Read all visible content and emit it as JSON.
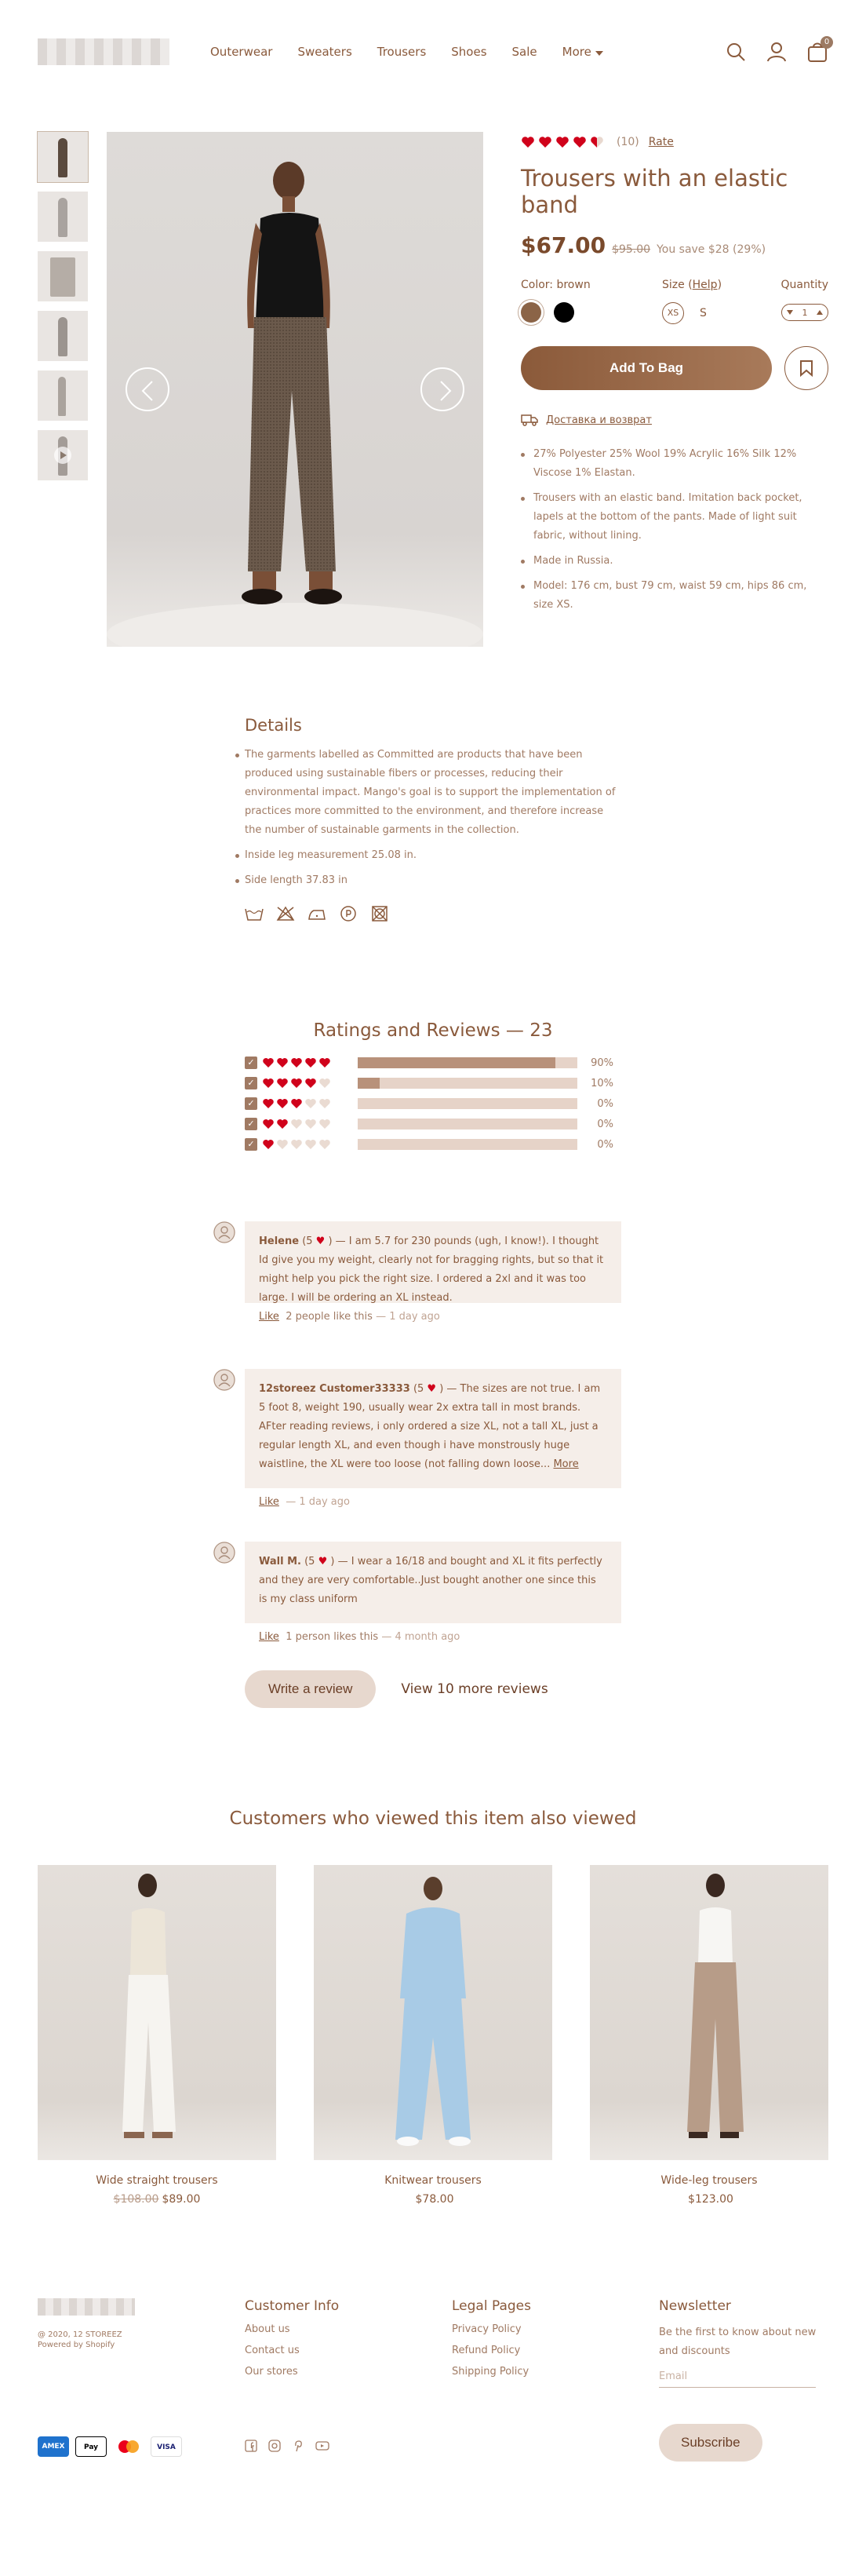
{
  "header": {
    "nav": [
      "Outerwear",
      "Sweaters",
      "Trousers",
      "Shoes",
      "Sale",
      "More"
    ],
    "cart_count": "0"
  },
  "product": {
    "rating_count": "(10)",
    "rate_label": "Rate",
    "rating_value": 4.5,
    "title": "Trousers with an elastic band",
    "price": "$67.00",
    "old_price": "$95.00",
    "save_text": "You save $28 (29%)",
    "color_label": "Color: brown",
    "colors": [
      "#8b6447",
      "#000000"
    ],
    "size_label": "Size (",
    "size_help": "Help",
    "size_label_end": ")",
    "size_selected": "XS",
    "size_alt": "S",
    "qty_label": "Quantity",
    "qty_value": "1",
    "add_to_bag": "Add To Bag",
    "delivery": "Доставка и возврат",
    "bullets": [
      "27% Polyester 25% Wool 19% Acrylic 16% Silk 12% Viscose 1% Elastan.",
      "Trousers with an elastic band. Imitation back pocket, lapels at the bottom of the pants. Made of light suit fabric, without lining.",
      "Made in Russia.",
      "Model: 176 cm, bust 79 cm, waist 59 cm, hips 86 cm, size XS."
    ]
  },
  "details": {
    "title": "Details",
    "items": [
      "The garments labelled as Committed are products that have been produced using sustainable fibers or processes, reducing their environmental impact. Mango's goal is to support the implementation of practices more committed to the environment, and therefore increase the number of sustainable garments in the collection.",
      "Inside leg measurement 25.08 in.",
      "Side length 37.83 in"
    ]
  },
  "ratings": {
    "title": "Ratings and Reviews — 23",
    "rows": [
      {
        "hearts": 5,
        "fraction": 0.9,
        "label": "90%"
      },
      {
        "hearts": 4,
        "fraction": 0.1,
        "label": "10%"
      },
      {
        "hearts": 3,
        "fraction": 0,
        "label": "0%"
      },
      {
        "hearts": 2,
        "fraction": 0,
        "label": "0%"
      },
      {
        "hearts": 1,
        "fraction": 0,
        "label": "0%"
      }
    ]
  },
  "reviews": [
    {
      "author": "Helene",
      "score_open": "(5",
      "score_close": ")",
      "text": " — I am 5.7 for 230 pounds (ugh, I know!). I thought Id give you my weight, clearly not for bragging rights, but so that it might help you pick the right size. I ordered a 2xl and it was too large. I will be ordering an XL instead.",
      "more": "",
      "like": "Like",
      "likes": "2 people like this",
      "time": "— 1 day ago"
    },
    {
      "author": "12storeez Customer33333",
      "score_open": "(5",
      "score_close": ")",
      "text": " — The sizes are not true. I am 5 foot 8, weight 190, usually wear 2x extra tall in most brands. AFter reading reviews, i only ordered a size XL, not a tall XL, just a regular length XL, and even though i have monstrously huge waistline, the XL were too loose (not falling down loose... ",
      "more": "More",
      "like": "Like",
      "likes": "",
      "time": "— 1 day ago"
    },
    {
      "author": "Wall M.",
      "score_open": "(5",
      "score_close": ")",
      "text": " — I wear a 16/18 and bought and XL it fits perfectly and they are very comfortable..Just bought another one since this is my class uniform",
      "more": "",
      "like": "Like",
      "likes": "1 person likes this",
      "time": "— 4 month ago"
    }
  ],
  "review_actions": {
    "write": "Write a review",
    "more": "View 10 more reviews"
  },
  "also_viewed": {
    "title": "Customers who viewed this item also viewed",
    "items": [
      {
        "name": "Wide straight trousers",
        "old_price": "$108.00",
        "price": "$89.00"
      },
      {
        "name": "Knitwear trousers",
        "old_price": "",
        "price": "$78.00"
      },
      {
        "name": "Wide-leg trousers",
        "old_price": "",
        "price": "$123.00"
      }
    ]
  },
  "footer": {
    "copyright": "@ 2020, 12 STOREEZ",
    "powered": "Powered by Shopify",
    "customer_info": {
      "title": "Customer Info",
      "links": [
        "About us",
        "Contact us",
        "Our stores"
      ]
    },
    "legal": {
      "title": "Legal Pages",
      "links": [
        "Privacy Policy",
        "Refund Policy",
        "Shipping Policy"
      ]
    },
    "newsletter": {
      "title": "Newsletter",
      "text": "Be the first to know about new and discounts",
      "placeholder": "Email",
      "button": "Subscribe"
    },
    "payments": [
      "AMEX",
      "Pay",
      "MC",
      "VISA"
    ]
  },
  "colors": {
    "accent": "#8a5a3c",
    "heart": "#d0021b",
    "panel": "#f5eee9",
    "pill": "#e7d8ce"
  }
}
